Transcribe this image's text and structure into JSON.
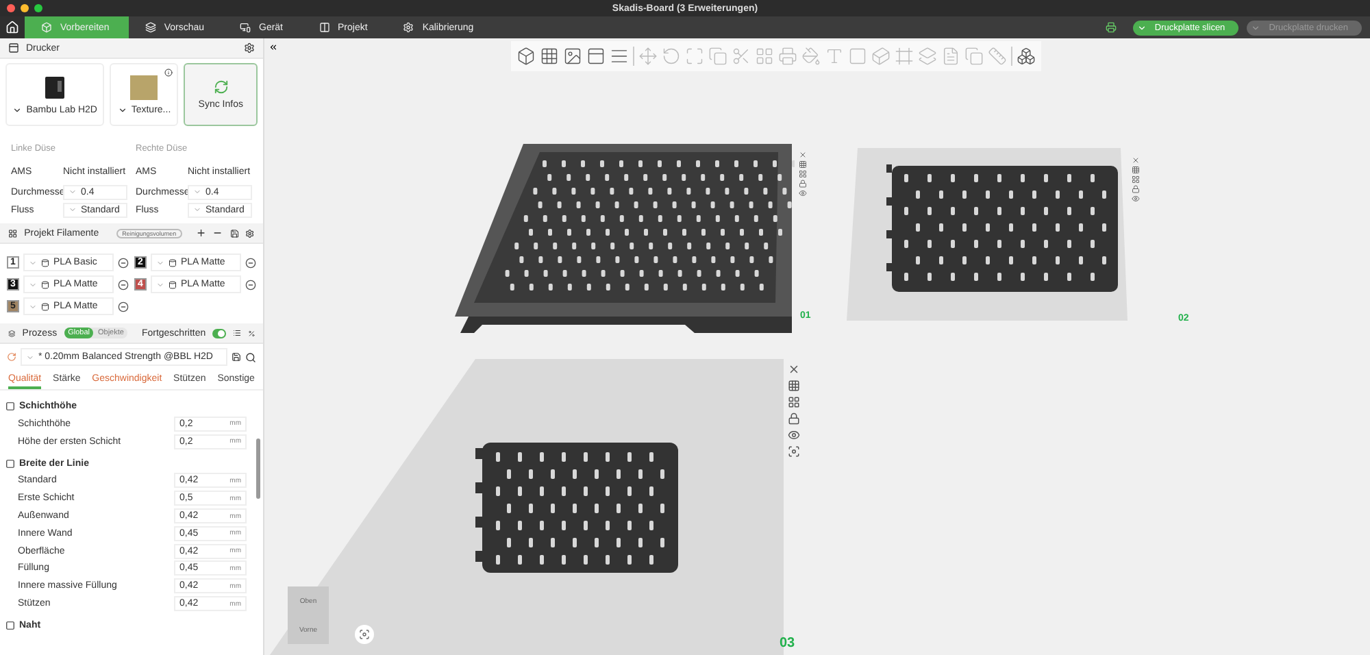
{
  "window": {
    "title": "Skadis-Board (3 Erweiterungen)"
  },
  "tabs": [
    {
      "label": "Vorbereiten",
      "selected": true
    },
    {
      "label": "Vorschau",
      "selected": false
    },
    {
      "label": "Gerät",
      "selected": false
    },
    {
      "label": "Projekt",
      "selected": false
    },
    {
      "label": "Kalibrierung",
      "selected": false
    }
  ],
  "actions": [
    {
      "label": "Druckplatte slicen",
      "disabled": false
    },
    {
      "label": "Druckplatte drucken",
      "disabled": true
    }
  ],
  "printer": {
    "title": "Drucker",
    "model": "Bambu Lab H2D",
    "plate": "Texture...",
    "sync": "Sync Infos"
  },
  "nozzles": [
    {
      "title": "Linke Düse",
      "ams_label": "AMS",
      "ams_value": "Nicht installiert",
      "diameter_label": "Durchmesse",
      "diameter": "0.4",
      "flow_label": "Fluss",
      "flow": "Standard"
    },
    {
      "title": "Rechte Düse",
      "ams_label": "AMS",
      "ams_value": "Nicht installiert",
      "diameter_label": "Durchmesse",
      "diameter": "0.4",
      "flow_label": "Fluss",
      "flow": "Standard"
    }
  ],
  "filaments": {
    "title": "Projekt Filamente",
    "badge": "Reinigungsvolumen",
    "items": [
      {
        "number": "1",
        "color": "#ffffff",
        "name": "PLA Basic"
      },
      {
        "number": "2",
        "color": "#111111",
        "name": "PLA Matte"
      },
      {
        "number": "3",
        "color": "#111111",
        "name": "PLA Matte"
      },
      {
        "number": "4",
        "color": "#c0504d",
        "name": "PLA Matte"
      },
      {
        "number": "5",
        "color": "#a08462",
        "name": "PLA Matte"
      }
    ]
  },
  "process": {
    "title": "Prozess",
    "scopes": [
      {
        "label": "Global",
        "selected": true
      },
      {
        "label": "Objekte",
        "selected": false
      }
    ],
    "advanced": {
      "label": "Fortgeschritten",
      "on": true
    },
    "preset": "* 0.20mm Balanced Strength @BBL H2D",
    "tabs": [
      {
        "label": "Qualität",
        "selected": true,
        "modified": true
      },
      {
        "label": "Stärke",
        "selected": false,
        "modified": false
      },
      {
        "label": "Geschwindigkeit",
        "selected": false,
        "modified": true
      },
      {
        "label": "Stützen",
        "selected": false,
        "modified": false
      },
      {
        "label": "Sonstige",
        "selected": false,
        "modified": false
      }
    ],
    "groups": [
      {
        "title": "Schichthöhe",
        "rows": [
          {
            "label": "Schichthöhe",
            "value": "0,2",
            "unit": "mm"
          },
          {
            "label": "Höhe der ersten Schicht",
            "value": "0,2",
            "unit": "mm"
          }
        ]
      },
      {
        "title": "Breite der Linie",
        "rows": [
          {
            "label": "Standard",
            "value": "0,42",
            "unit": "mm"
          },
          {
            "label": "Erste Schicht",
            "value": "0,5",
            "unit": "mm"
          },
          {
            "label": "Außenwand",
            "value": "0,42",
            "unit": "mm"
          },
          {
            "label": "Innere Wand",
            "value": "0,45",
            "unit": "mm"
          },
          {
            "label": "Oberfläche",
            "value": "0,42",
            "unit": "mm"
          },
          {
            "label": "Füllung",
            "value": "0,45",
            "unit": "mm"
          },
          {
            "label": "Innere massive Füllung",
            "value": "0,42",
            "unit": "mm"
          },
          {
            "label": "Stützen",
            "value": "0,42",
            "unit": "mm"
          }
        ]
      },
      {
        "title": "Naht"
      }
    ]
  },
  "plates": [
    {
      "label": "01"
    },
    {
      "label": "02"
    },
    {
      "label": "03"
    }
  ],
  "view_cube": {
    "top": "Oben",
    "front": "Vorne"
  }
}
